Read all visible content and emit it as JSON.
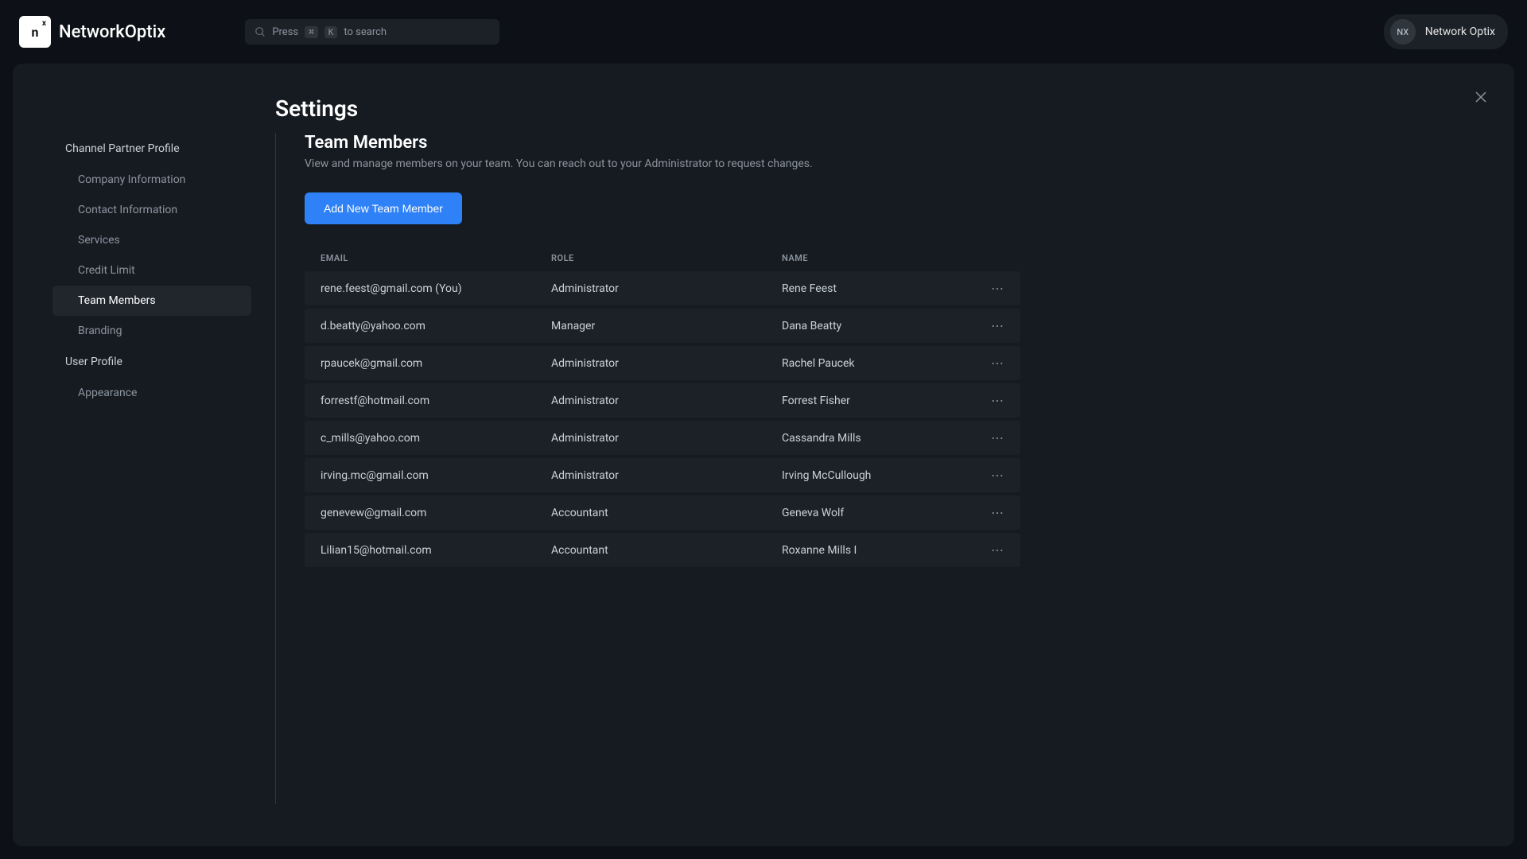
{
  "brand": {
    "logo_short": "n",
    "name": "NetworkOptix"
  },
  "search": {
    "prefix": "Press",
    "key1": "⌘",
    "key2": "K",
    "suffix": "to search"
  },
  "user": {
    "initials": "NX",
    "name": "Network Optix"
  },
  "page": {
    "title": "Settings"
  },
  "sidebar": {
    "sections": [
      {
        "title": "Channel Partner Profile",
        "items": [
          {
            "label": "Company Information",
            "active": false
          },
          {
            "label": "Contact Information",
            "active": false
          },
          {
            "label": "Services",
            "active": false
          },
          {
            "label": "Credit Limit",
            "active": false
          },
          {
            "label": "Team Members",
            "active": true
          },
          {
            "label": "Branding",
            "active": false
          }
        ]
      },
      {
        "title": "User Profile",
        "items": [
          {
            "label": "Appearance",
            "active": false
          }
        ]
      }
    ]
  },
  "detail": {
    "title": "Team Members",
    "subtitle": "View and manage members on your team. You can reach out to your Administrator to request changes.",
    "add_button": "Add New Team Member"
  },
  "table": {
    "headers": {
      "email": "Email",
      "role": "Role",
      "name": "Name"
    },
    "rows": [
      {
        "email": "rene.feest@gmail.com (You)",
        "role": "Administrator",
        "name": "Rene Feest"
      },
      {
        "email": "d.beatty@yahoo.com",
        "role": "Manager",
        "name": "Dana Beatty"
      },
      {
        "email": "rpaucek@gmail.com",
        "role": "Administrator",
        "name": "Rachel Paucek"
      },
      {
        "email": "forrestf@hotmail.com",
        "role": "Administrator",
        "name": "Forrest Fisher"
      },
      {
        "email": "c_mills@yahoo.com",
        "role": "Administrator",
        "name": "Cassandra Mills"
      },
      {
        "email": "irving.mc@gmail.com",
        "role": "Administrator",
        "name": "Irving McCullough"
      },
      {
        "email": "genevew@gmail.com",
        "role": "Accountant",
        "name": "Geneva Wolf"
      },
      {
        "email": "Lilian15@hotmail.com",
        "role": "Accountant",
        "name": "Roxanne Mills I"
      }
    ]
  }
}
